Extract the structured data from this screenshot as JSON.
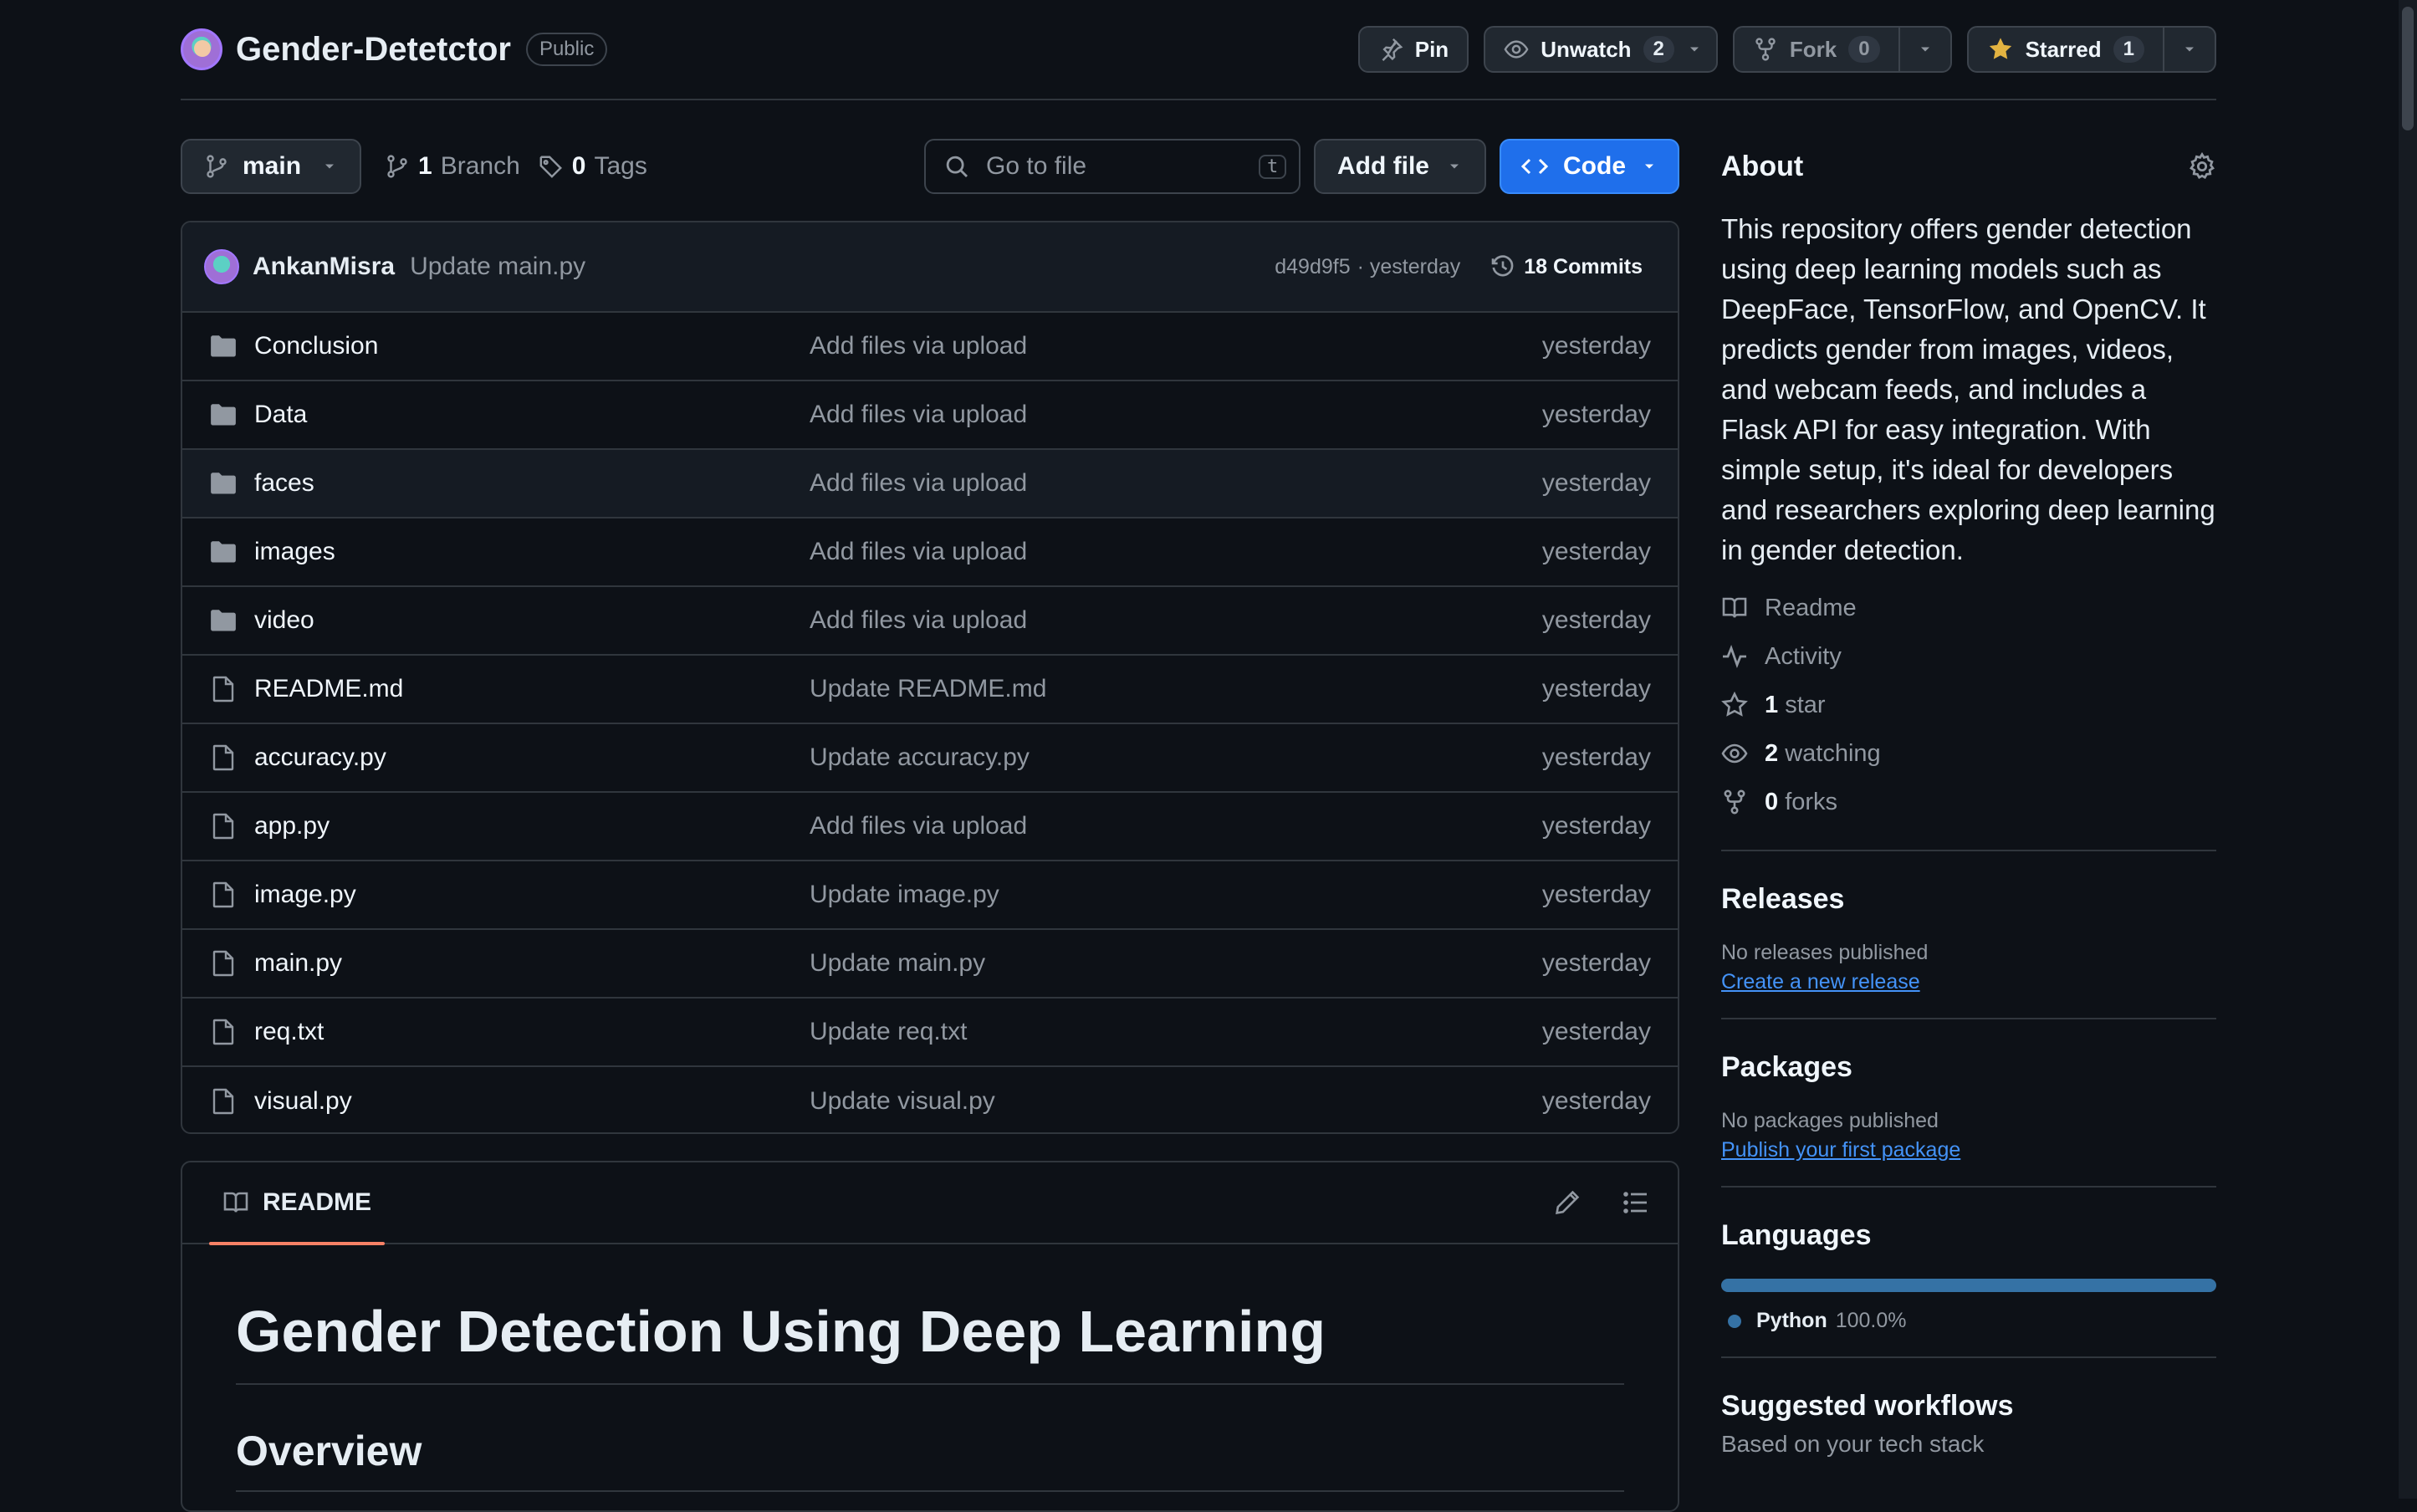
{
  "repo": {
    "name": "Gender-Detetctor",
    "visibility": "Public"
  },
  "header_actions": {
    "pin_label": "Pin",
    "unwatch_label": "Unwatch",
    "watch_count": "2",
    "fork_label": "Fork",
    "fork_count": "0",
    "star_label": "Starred",
    "star_count": "1"
  },
  "toolbar": {
    "branch": "main",
    "branch_count": "1",
    "branch_label": "Branch",
    "tag_count": "0",
    "tag_label": "Tags",
    "search_placeholder": "Go to file",
    "search_shortcut": "t",
    "add_file_label": "Add file",
    "code_label": "Code"
  },
  "latest_commit": {
    "author": "AnkanMisra",
    "message": "Update main.py",
    "hash": "d49d9f5",
    "time": "· yesterday",
    "commits_label": "18 Commits"
  },
  "files": [
    {
      "name": "Conclusion",
      "type": "folder",
      "commit": "Add files via upload",
      "time": "yesterday"
    },
    {
      "name": "Data",
      "type": "folder",
      "commit": "Add files via upload",
      "time": "yesterday"
    },
    {
      "name": "faces",
      "type": "folder",
      "commit": "Add files via upload",
      "time": "yesterday"
    },
    {
      "name": "images",
      "type": "folder",
      "commit": "Add files via upload",
      "time": "yesterday"
    },
    {
      "name": "video",
      "type": "folder",
      "commit": "Add files via upload",
      "time": "yesterday"
    },
    {
      "name": "README.md",
      "type": "file",
      "commit": "Update README.md",
      "time": "yesterday"
    },
    {
      "name": "accuracy.py",
      "type": "file",
      "commit": "Update accuracy.py",
      "time": "yesterday"
    },
    {
      "name": "app.py",
      "type": "file",
      "commit": "Add files via upload",
      "time": "yesterday"
    },
    {
      "name": "image.py",
      "type": "file",
      "commit": "Update image.py",
      "time": "yesterday"
    },
    {
      "name": "main.py",
      "type": "file",
      "commit": "Update main.py",
      "time": "yesterday"
    },
    {
      "name": "req.txt",
      "type": "file",
      "commit": "Update req.txt",
      "time": "yesterday"
    },
    {
      "name": "visual.py",
      "type": "file",
      "commit": "Update visual.py",
      "time": "yesterday"
    }
  ],
  "readme": {
    "tab_label": "README",
    "h1": "Gender Detection Using Deep Learning",
    "h2": "Overview"
  },
  "about": {
    "heading": "About",
    "description": "This repository offers gender detection using deep learning models such as DeepFace, TensorFlow, and OpenCV. It predicts gender from images, videos, and webcam feeds, and includes a Flask API for easy integration. With simple setup, it's ideal for developers and researchers exploring deep learning in gender detection.",
    "readme_link": "Readme",
    "activity_link": "Activity",
    "stars_count": "1",
    "stars_label": "star",
    "watching_count": "2",
    "watching_label": "watching",
    "forks_count": "0",
    "forks_label": "forks"
  },
  "releases": {
    "heading": "Releases",
    "empty_text": "No releases published",
    "create_link": "Create a new release"
  },
  "packages": {
    "heading": "Packages",
    "empty_text": "No packages published",
    "publish_link": "Publish your first package"
  },
  "languages": {
    "heading": "Languages",
    "items": [
      {
        "name": "Python",
        "percent": "100.0%",
        "color": "#3572a5"
      }
    ]
  },
  "workflows": {
    "heading": "Suggested workflows",
    "subtext": "Based on your tech stack"
  },
  "colors": {
    "background": "#0d1117",
    "border": "#30363d",
    "accent": "#1f6feb",
    "link": "#4493f8",
    "star": "#e3b341",
    "tab_underline": "#f78166"
  }
}
